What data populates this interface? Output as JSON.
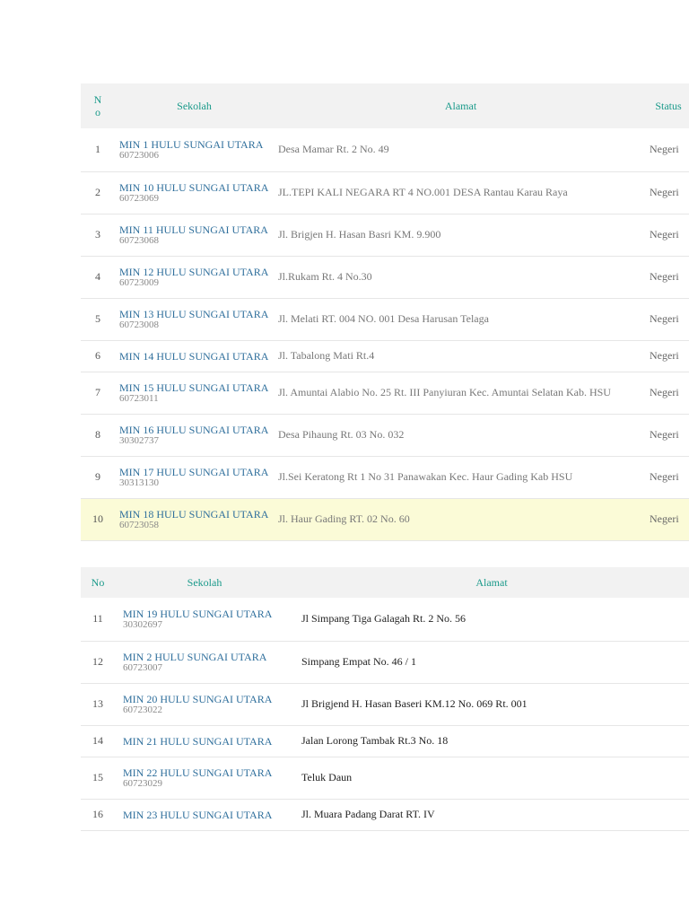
{
  "table1": {
    "headers": {
      "no": "No",
      "school": "Sekolah",
      "address": "Alamat",
      "status": "Status"
    },
    "rows": [
      {
        "no": "1",
        "name": "MIN 1 HULU SUNGAI UTARA",
        "npsn": "60723006",
        "address": "Desa Mamar Rt. 2 No. 49",
        "status": "Negeri"
      },
      {
        "no": "2",
        "name": "MIN 10 HULU SUNGAI UTARA",
        "npsn": "60723069",
        "address": "JL.TEPI KALI NEGARA RT 4 NO.001 DESA Rantau Karau Raya",
        "status": "Negeri"
      },
      {
        "no": "3",
        "name": "MIN 11 HULU SUNGAI UTARA",
        "npsn": "60723068",
        "address": "Jl. Brigjen H. Hasan Basri KM. 9.900",
        "status": "Negeri"
      },
      {
        "no": "4",
        "name": "MIN 12 HULU SUNGAI UTARA",
        "npsn": "60723009",
        "address": "Jl.Rukam Rt. 4 No.30",
        "status": "Negeri"
      },
      {
        "no": "5",
        "name": "MIN 13 HULU SUNGAI UTARA",
        "npsn": "60723008",
        "address": "Jl. Melati RT. 004 NO. 001 Desa Harusan Telaga",
        "status": "Negeri"
      },
      {
        "no": "6",
        "name": "MIN 14 HULU SUNGAI UTARA",
        "npsn": "",
        "address": "Jl. Tabalong Mati Rt.4",
        "status": "Negeri"
      },
      {
        "no": "7",
        "name": "MIN 15 HULU SUNGAI UTARA",
        "npsn": "60723011",
        "address": "Jl. Amuntai Alabio No. 25 Rt. III Panyiuran Kec. Amuntai Selatan Kab. HSU",
        "status": "Negeri"
      },
      {
        "no": "8",
        "name": "MIN 16 HULU SUNGAI UTARA",
        "npsn": "30302737",
        "address": "Desa Pihaung Rt. 03 No. 032",
        "status": "Negeri"
      },
      {
        "no": "9",
        "name": "MIN 17 HULU SUNGAI UTARA",
        "npsn": "30313130",
        "address": "Jl.Sei Keratong Rt 1 No 31 Panawakan Kec. Haur Gading Kab HSU",
        "status": "Negeri"
      },
      {
        "no": "10",
        "name": "MIN 18 HULU SUNGAI UTARA",
        "npsn": "60723058",
        "address": "Jl. Haur Gading RT. 02 No. 60",
        "status": "Negeri"
      }
    ]
  },
  "table2": {
    "headers": {
      "no": "No",
      "school": "Sekolah",
      "address": "Alamat"
    },
    "rows": [
      {
        "no": "11",
        "name": "MIN 19 HULU SUNGAI UTARA",
        "npsn": "30302697",
        "address": "Jl Simpang Tiga Galagah Rt. 2 No. 56"
      },
      {
        "no": "12",
        "name": "MIN 2 HULU SUNGAI UTARA",
        "npsn": "60723007",
        "address": "Simpang Empat No. 46 / 1"
      },
      {
        "no": "13",
        "name": "MIN 20 HULU SUNGAI UTARA",
        "npsn": "60723022",
        "address": "Jl Brigjend H. Hasan Baseri KM.12 No. 069 Rt. 001"
      },
      {
        "no": "14",
        "name": "MIN 21 HULU SUNGAI UTARA",
        "npsn": "",
        "address": "Jalan Lorong Tambak Rt.3 No. 18"
      },
      {
        "no": "15",
        "name": "MIN 22 HULU SUNGAI UTARA",
        "npsn": "60723029",
        "address": "Teluk Daun"
      },
      {
        "no": "16",
        "name": "MIN 23 HULU SUNGAI UTARA",
        "npsn": "",
        "address": "Jl. Muara Padang Darat RT. IV"
      }
    ]
  },
  "colors": {
    "header_text": "#1a9a8a",
    "header_bg": "#f2f2f2",
    "link": "#2f6f9c",
    "highlight_bg": "#fbfbd7"
  }
}
